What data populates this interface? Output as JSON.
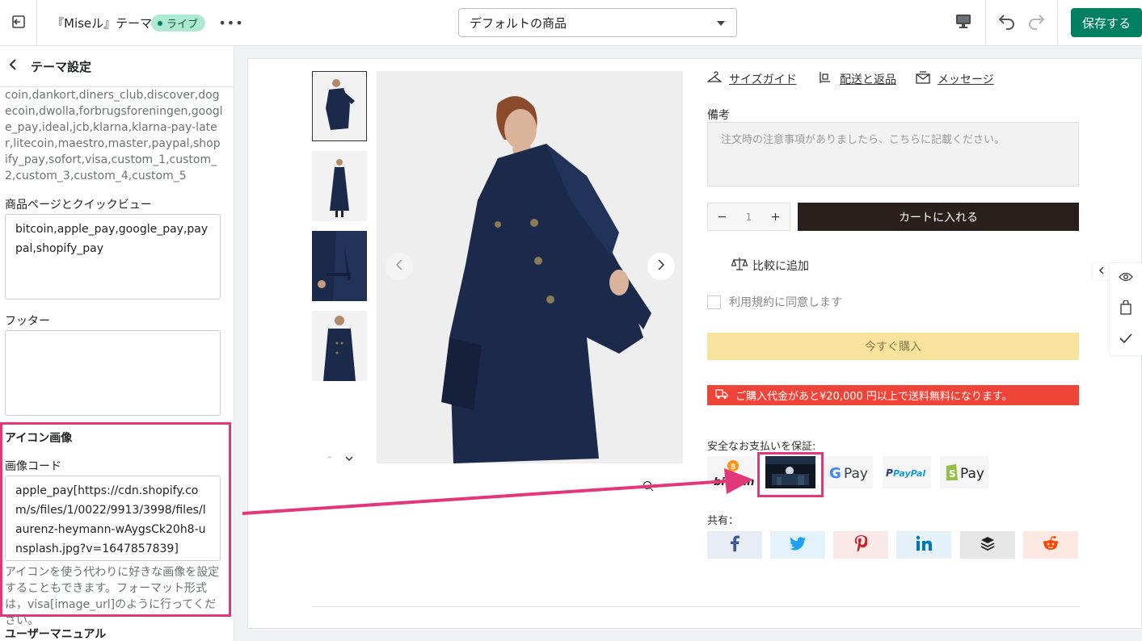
{
  "topbar": {
    "theme_name": "『Miseル』テーマ",
    "live_badge": "ライブ",
    "more": "•••",
    "template_select": "デフォルトの商品",
    "save": "保存する"
  },
  "sidebar": {
    "title": "テーマ設定",
    "icons_list_text": "coin,dankort,diners_club,discover,dogecoin,dwolla,forbrugsforeningen,google_pay,ideal,jcb,klarna,klarna-pay-later,litecoin,maestro,master,paypal,shopify_pay,sofort,visa,custom_1,custom_2,custom_3,custom_4,custom_5",
    "product_page_label": "商品ページとクイックビュー",
    "product_page_value": "bitcoin,apple_pay,google_pay,paypal,shopify_pay",
    "footer_label": "フッター",
    "footer_value": "",
    "icon_image_heading": "アイコン画像",
    "image_code_label": "画像コード",
    "image_code_value": "apple_pay[https://cdn.shopify.com/s/files/1/0022/9913/3998/files/laurenz-heymann-wAygsCk20h8-unsplash.jpg?v=1647857839]",
    "image_code_help": "アイコンを使う代わりに好きな画像を設定することもできます。フォーマット形式は，visa[image_url]のように行ってください。",
    "user_manual_heading": "ユーザーマニュアル"
  },
  "product": {
    "size_guide": "サイズガイド",
    "shipping_returns": "配送と返品",
    "message": "メッセージ",
    "note_label": "備考",
    "note_placeholder": "注文時の注意事項がありましたら、こちらに記載ください。",
    "qty_minus": "−",
    "qty_value": "1",
    "qty_plus": "+",
    "add_to_cart": "カートに入れる",
    "compare": "比較に追加",
    "agree_terms": "利用規約に同意します",
    "buy_now": "今すぐ購入",
    "shipping_notice": "ご購入代金があと¥20,000 円以上で送料無料になります。",
    "secure_payment_label": "安全なお支払いを保証:",
    "payment_icons": [
      "bitcoin",
      "apple_pay",
      "google_pay",
      "paypal",
      "shopify_pay"
    ],
    "payment_texts": {
      "bitcoin": "bitcoin",
      "gpay": "Pay",
      "paypal": "PayPal",
      "shopify": "Pay"
    },
    "share_label": "共有：",
    "share_buttons": [
      "facebook",
      "twitter",
      "pinterest",
      "linkedin",
      "buffer",
      "reddit"
    ]
  },
  "colors": {
    "save_green": "#008060",
    "highlight_pink": "#e2387a",
    "cart_dark": "#2b1f1d",
    "buy_yellow": "#f8e39d",
    "shipping_red": "#f04438",
    "coat_navy": "#1b2a4a"
  }
}
